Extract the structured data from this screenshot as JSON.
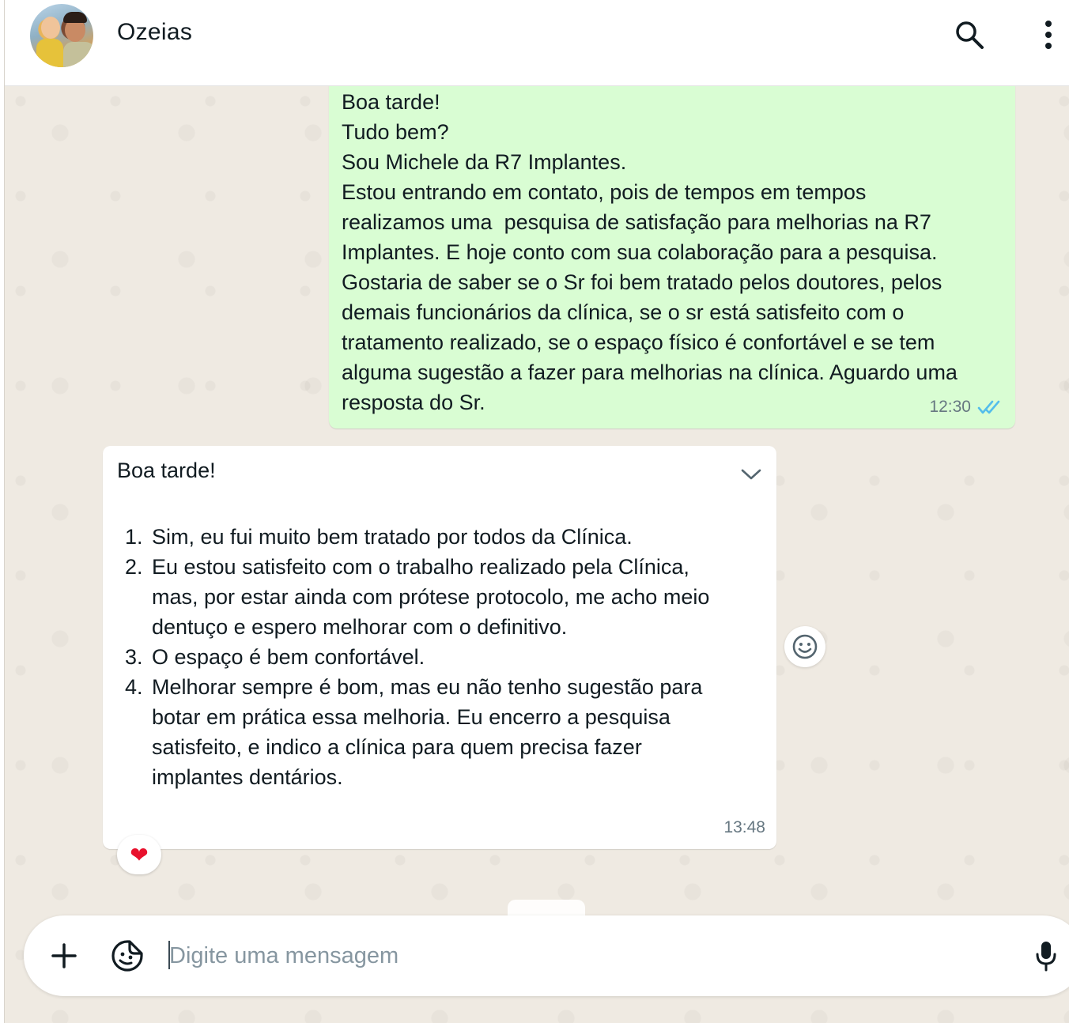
{
  "header": {
    "contact_name": "Ozeias",
    "search_icon": "search-icon",
    "menu_icon": "more-vert-icon"
  },
  "outgoing_message": {
    "lines": [
      "Boa tarde!",
      "Tudo bem?",
      "Sou Michele da R7 Implantes.",
      "Estou entrando em contato, pois de tempos em tempos",
      "realizamos uma  pesquisa de satisfação para melhorias na R7",
      "Implantes. E hoje conto com sua colaboração para a pesquisa.",
      "Gostaria de saber se o Sr foi bem tratado pelos doutores, pelos",
      "demais funcionários da clínica, se o sr está satisfeito com o",
      "tratamento realizado, se o espaço físico é confortável e se tem",
      "alguma sugestão a fazer para melhorias na clínica. Aguardo uma",
      "resposta do Sr."
    ],
    "time": "12:30",
    "status_icon": "double-check-read-icon",
    "bubble_color": "#d9fdd3",
    "tick_color": "#53bdeb"
  },
  "incoming_message": {
    "greeting": "Boa tarde!",
    "items": [
      {
        "num": "1.",
        "lines": [
          "Sim, eu fui muito bem tratado por todos da Clínica."
        ]
      },
      {
        "num": "2.",
        "lines": [
          "Eu estou satisfeito com o trabalho realizado pela Clínica,",
          "mas, por estar ainda com prótese protocolo, me acho meio",
          "dentuço e espero melhorar com o definitivo."
        ]
      },
      {
        "num": "3.",
        "lines": [
          "O espaço é bem confortável."
        ]
      },
      {
        "num": "4.",
        "lines": [
          "Melhorar sempre é bom, mas eu não tenho sugestão para",
          "botar em prática essa melhoria. Eu encerro a pesquisa",
          "satisfeito, e indico a clínica para quem precisa fazer",
          "implantes dentários."
        ]
      }
    ],
    "time": "13:48",
    "reaction": "❤",
    "reaction_color": "#e8112d"
  },
  "composer": {
    "placeholder": "Digite uma mensagem",
    "value": ""
  },
  "colors": {
    "chat_background": "#efeae2",
    "incoming_bubble": "#ffffff"
  }
}
